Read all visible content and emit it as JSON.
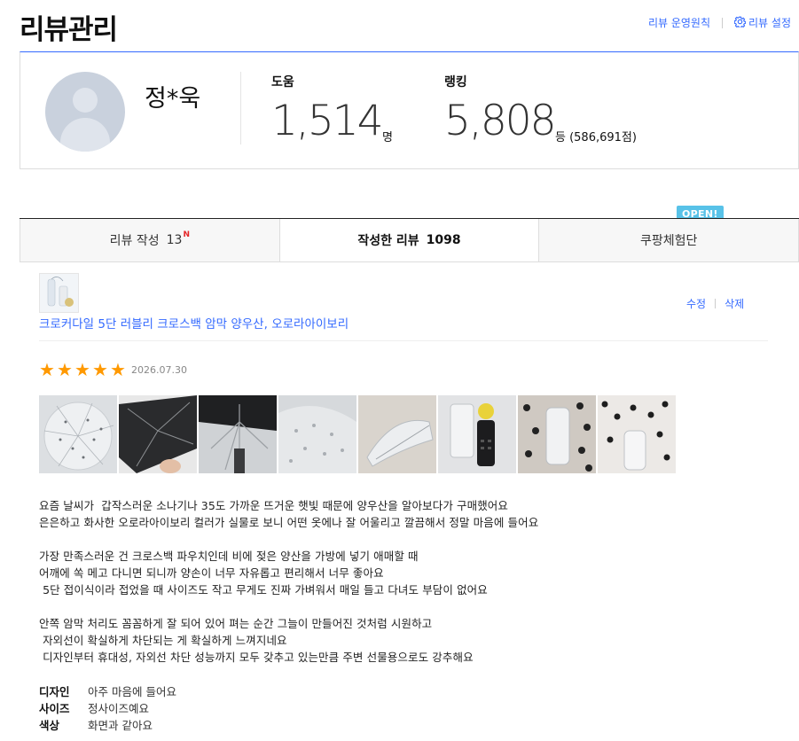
{
  "header": {
    "title": "리뷰관리",
    "guide_link": "리뷰 운영원칙",
    "settings_link": "리뷰 설정"
  },
  "profile": {
    "name": "정*욱",
    "help_label": "도움",
    "help_value": "1,514",
    "help_unit": "명",
    "rank_label": "랭킹",
    "rank_value": "5,808",
    "rank_unit": "등 (586,691점)"
  },
  "tabs": [
    {
      "label": "리뷰 작성",
      "count": "13",
      "badge": "N"
    },
    {
      "label": "작성한 리뷰",
      "count": "1098"
    },
    {
      "label": "쿠팡체험단",
      "badge": "OPEN!"
    }
  ],
  "review": {
    "product_name": "크로커다일 5단 러블리 크로스백 암막 양우산, 오로라아이보리",
    "edit_label": "수정",
    "delete_label": "삭제",
    "rating": 5,
    "date": "2026.07.30",
    "photo_count": 8,
    "lines": [
      "요즘 날씨가  갑작스러운 소나기나 35도 가까운 뜨거운 햇빛 때문에 양우산을 알아보다가 구매했어요",
      "은은하고 화사한 오로라아이보리 컬러가 실물로 보니 어떤 옷에나 잘 어울리고 깔끔해서 정말 마음에 들어요",
      "",
      "가장 만족스러운 건 크로스백 파우치인데 비에 젖은 양산을 가방에 넣기 애매할 때",
      "어깨에 쏙 메고 다니면 되니까 양손이 너무 자유롭고 편리해서 너무 좋아요",
      " 5단 접이식이라 접었을 때 사이즈도 작고 무게도 진짜 가벼워서 매일 들고 다녀도 부담이 없어요",
      "",
      "안쪽 암막 처리도 꼼꼼하게 잘 되어 있어 펴는 순간 그늘이 만들어진 것처럼 시원하고",
      " 자외선이 확실하게 차단되는 게 확실하게 느껴지네요",
      " 디자인부터 휴대성, 자외선 차단 성능까지 모두 갖추고 있는만큼 주변 선물용으로도 강추해요"
    ],
    "attributes": [
      {
        "key": "디자인",
        "value": "아주 마음에 들어요"
      },
      {
        "key": "사이즈",
        "value": "정사이즈예요"
      },
      {
        "key": "색상",
        "value": "화면과 같아요"
      }
    ]
  },
  "colors": {
    "link": "#346aff",
    "star": "#ff9900",
    "badge": "#58c2e8",
    "new_badge": "#e52528"
  }
}
